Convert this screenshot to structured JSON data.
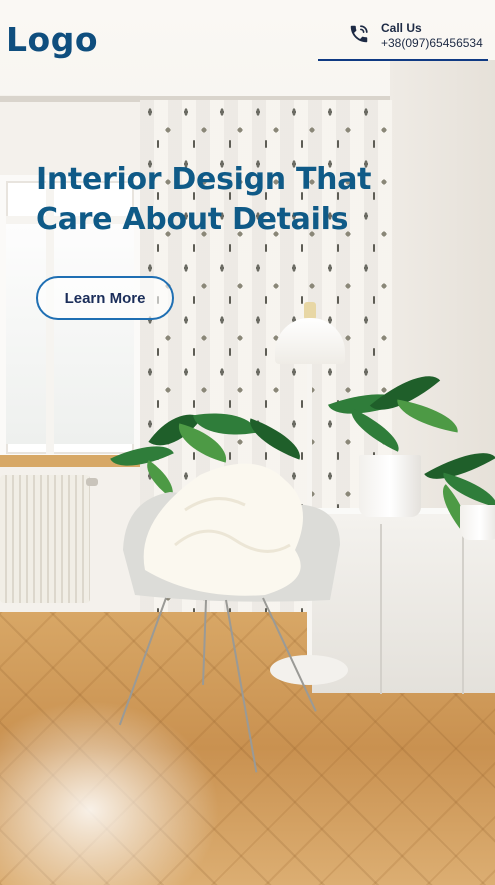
{
  "header": {
    "logo": "Logo",
    "call": {
      "label": "Call Us",
      "number": "+38(097)65456534",
      "icon": "phone-icon"
    }
  },
  "hero": {
    "headline": "Interior Design That Care About Details",
    "cta_label": "Learn More",
    "background_image": "interior-room-photo"
  },
  "colors": {
    "brand": "#0f4e7e",
    "headline": "#0f5a87",
    "cta_border": "#1f6fb3",
    "underline": "#0f3a83"
  }
}
